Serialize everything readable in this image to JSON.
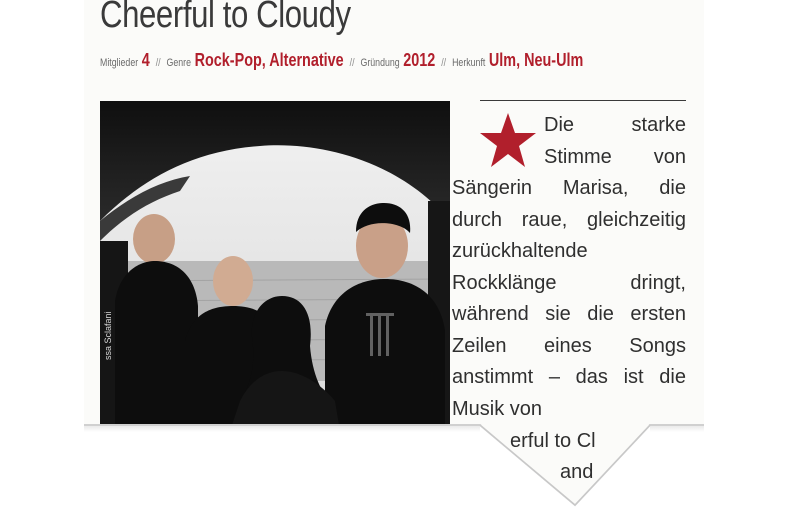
{
  "band": {
    "name": "Cheerful to Cloudy"
  },
  "meta": {
    "members_label": "Mitglieder",
    "members_value": "4",
    "genre_label": "Genre",
    "genre_value": "Rock-Pop, Alternative",
    "founded_label": "Gründung",
    "founded_value": "2012",
    "origin_label": "Herkunft",
    "origin_value": "Ulm, Neu-Ulm",
    "separator": "//"
  },
  "photo": {
    "credit": "ssa Sclafani"
  },
  "article": {
    "text": "Die starke Stimme von Sängerin Marisa, die durch raue, gleichzeitig zurückhaltende Rockklänge dringt, während sie die ersten Zeilen eines Songs anstimmt – das ist die Musik von",
    "cut_line_1": "erful to Cl",
    "cut_line_2": "and"
  },
  "colors": {
    "accent": "#b11f2c"
  },
  "icons": {
    "star": "star-icon"
  }
}
